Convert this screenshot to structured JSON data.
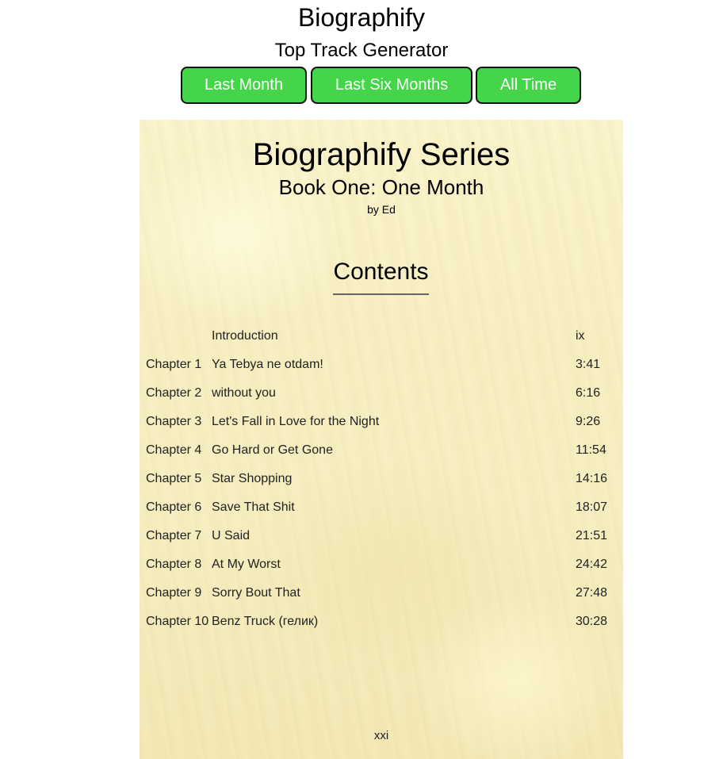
{
  "header": {
    "app_title": "Biographify",
    "subtitle": "Top Track Generator",
    "buttons": {
      "last_month": "Last Month",
      "last_six_months": "Last Six Months",
      "all_time": "All Time"
    },
    "button_color": "#44d54a"
  },
  "book": {
    "series_title": "Biographify Series",
    "book_title": "Book One: One Month",
    "author": "by Ed",
    "contents_heading": "Contents",
    "page_number": "xxi",
    "toc": [
      {
        "chapter": "",
        "title": "Introduction",
        "time": "ix"
      },
      {
        "chapter": "Chapter 1",
        "title": "Ya Tebya ne otdam!",
        "time": "3:41"
      },
      {
        "chapter": "Chapter 2",
        "title": "without you",
        "time": "6:16"
      },
      {
        "chapter": "Chapter 3",
        "title": "Let's Fall in Love for the Night",
        "time": "9:26"
      },
      {
        "chapter": "Chapter 4",
        "title": "Go Hard or Get Gone",
        "time": "11:54"
      },
      {
        "chapter": "Chapter 5",
        "title": "Star Shopping",
        "time": "14:16"
      },
      {
        "chapter": "Chapter 6",
        "title": "Save That Shit",
        "time": "18:07"
      },
      {
        "chapter": "Chapter 7",
        "title": "U Said",
        "time": "21:51"
      },
      {
        "chapter": "Chapter 8",
        "title": "At My Worst",
        "time": "24:42"
      },
      {
        "chapter": "Chapter 9",
        "title": "Sorry Bout That",
        "time": "27:48"
      },
      {
        "chapter": "Chapter 10",
        "title": "Benz Truck (гелик)",
        "time": "30:28"
      }
    ]
  }
}
